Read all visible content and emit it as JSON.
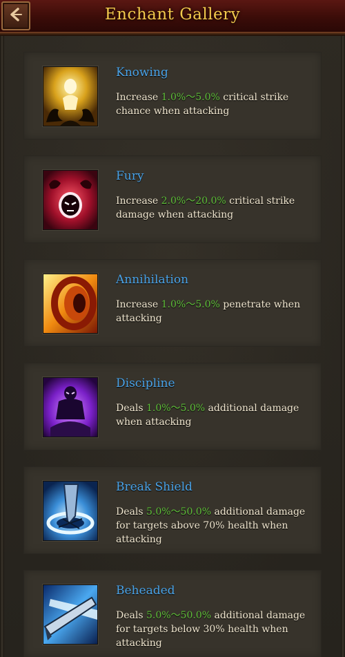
{
  "header": {
    "title": "Enchant Gallery",
    "back_icon": "back-arrow-icon"
  },
  "colors": {
    "name": "#4aa3e8",
    "range": "#5fbf3a",
    "description": "#f0e6cf",
    "title": "#f2c94c"
  },
  "enchants": [
    {
      "name": "Knowing",
      "pre": "Increase ",
      "range": "1.0%～5.0%",
      "post": " critical strike chance when attacking",
      "icon": "knowing-icon"
    },
    {
      "name": "Fury",
      "pre": "Increase ",
      "range": "2.0%～20.0%",
      "post": " critical strike damage when attacking",
      "icon": "fury-icon"
    },
    {
      "name": "Annihilation",
      "pre": "Increase ",
      "range": "1.0%～5.0%",
      "post": " penetrate when attacking",
      "icon": "annihilation-icon"
    },
    {
      "name": "Discipline",
      "pre": "Deals ",
      "range": "1.0%～5.0%",
      "post": " additional damage when attacking",
      "icon": "discipline-icon"
    },
    {
      "name": "Break Shield",
      "pre": "Deals ",
      "range": "5.0%～50.0%",
      "post": " additional damage for targets above 70% health when attacking",
      "icon": "break-shield-icon"
    },
    {
      "name": "Beheaded",
      "pre": "Deals ",
      "range": "5.0%～50.0%",
      "post": " additional damage for targets below 30% health when attacking",
      "icon": "beheaded-icon"
    }
  ]
}
